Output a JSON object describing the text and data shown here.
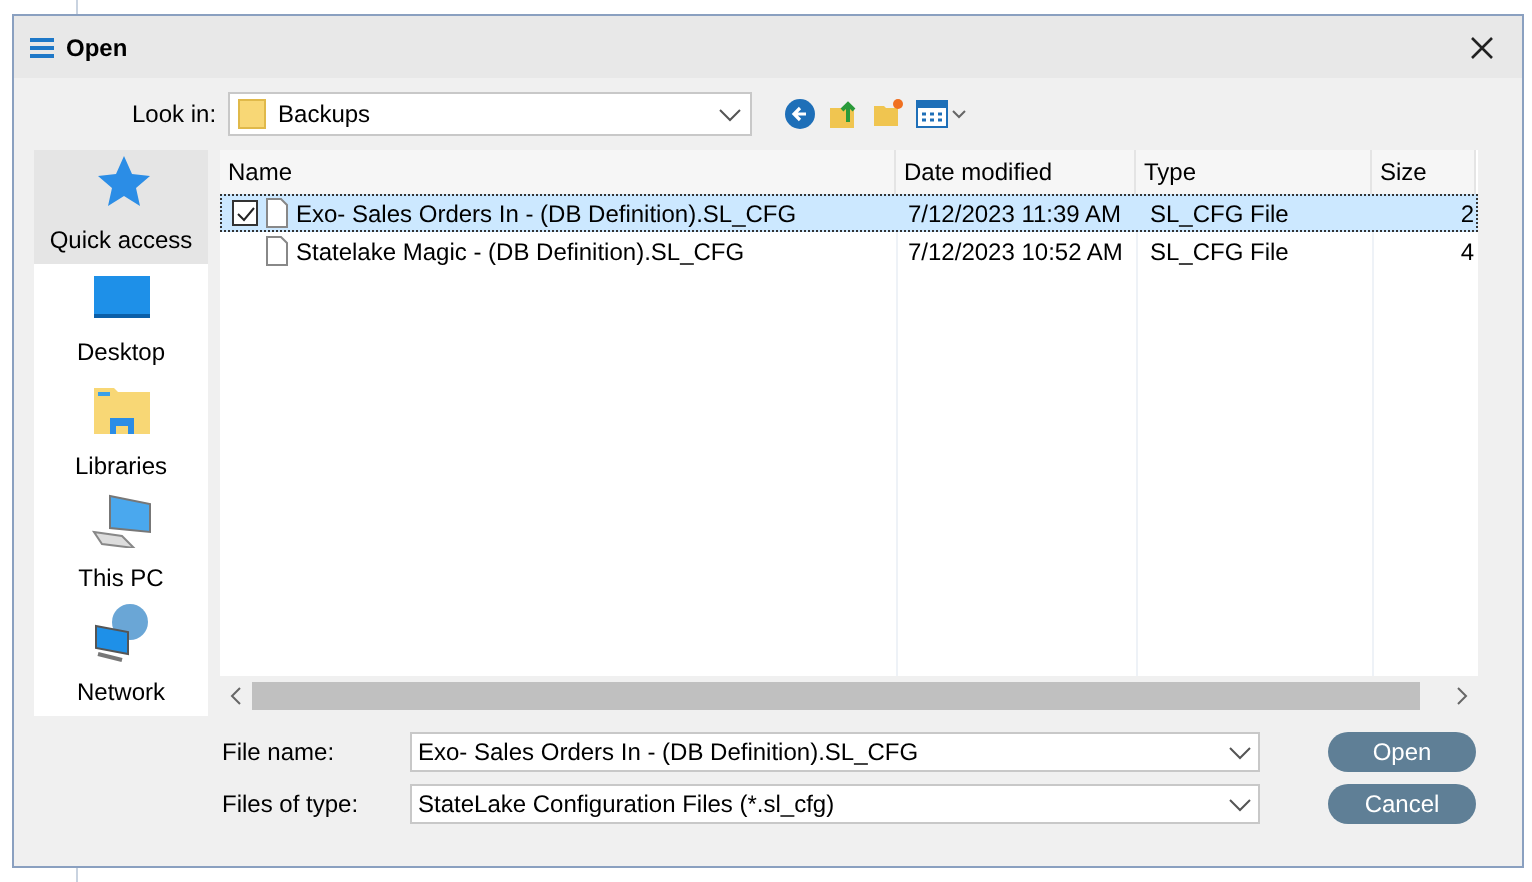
{
  "window": {
    "title": "Open"
  },
  "look_in": {
    "label": "Look in:",
    "value": "Backups"
  },
  "places": [
    {
      "kind": "star",
      "label": "Quick access",
      "selected": true
    },
    {
      "kind": "desktop",
      "label": "Desktop",
      "selected": false
    },
    {
      "kind": "library",
      "label": "Libraries",
      "selected": false
    },
    {
      "kind": "pc",
      "label": "This PC",
      "selected": false
    },
    {
      "kind": "network",
      "label": "Network",
      "selected": false
    }
  ],
  "table": {
    "columns": [
      "Name",
      "Date modified",
      "Type",
      "Size"
    ],
    "rows": [
      {
        "name": "Exo- Sales Orders In - (DB Definition).SL_CFG",
        "date": "7/12/2023 11:39 AM",
        "type": "SL_CFG File",
        "size": "2",
        "selected": true,
        "checked": true
      },
      {
        "name": "Statelake Magic - (DB Definition).SL_CFG",
        "date": "7/12/2023 10:52 AM",
        "type": "SL_CFG File",
        "size": "4",
        "selected": false,
        "checked": false
      }
    ]
  },
  "file_name": {
    "label": "File name:",
    "value": "Exo- Sales Orders In - (DB Definition).SL_CFG"
  },
  "file_type": {
    "label": "Files of type:",
    "value": "StateLake Configuration Files (*.sl_cfg)"
  },
  "buttons": [
    "Open",
    "Cancel"
  ]
}
